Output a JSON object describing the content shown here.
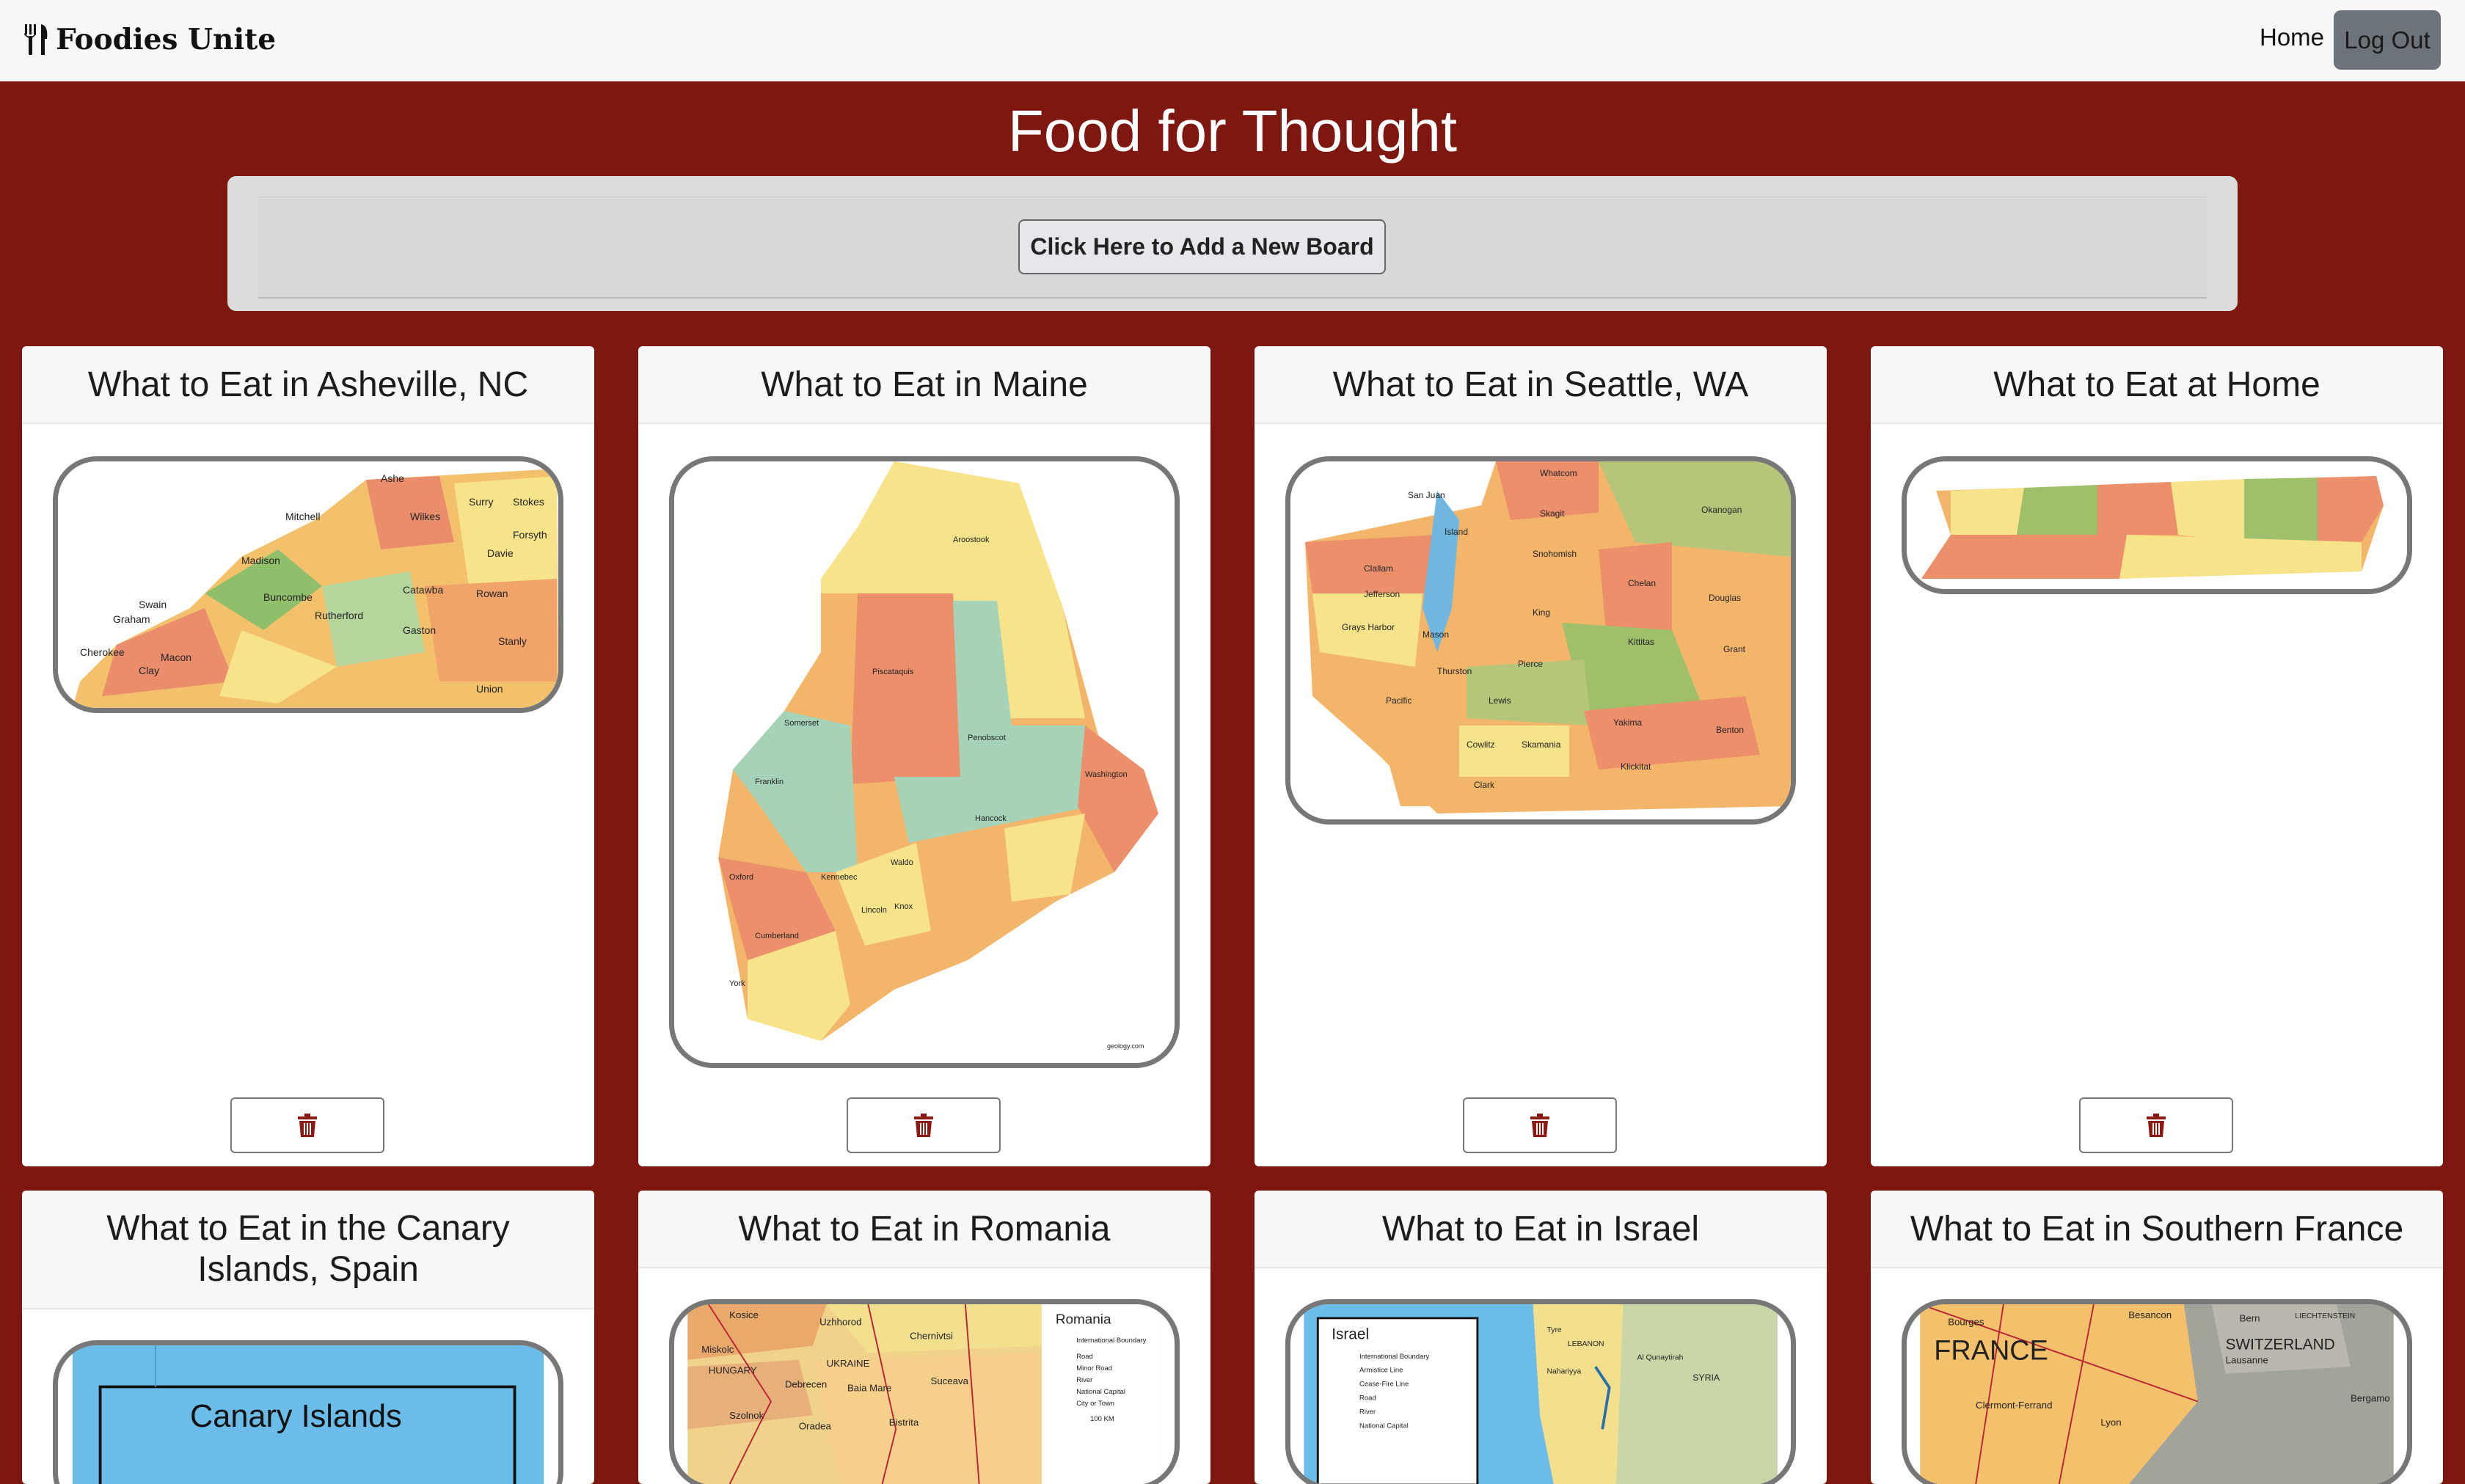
{
  "navbar": {
    "brand": "Foodies Unite",
    "brand_icon": "utensils-icon",
    "home_label": "Home",
    "logout_label": "Log Out"
  },
  "page": {
    "title": "Food for Thought",
    "add_board_label": "Click Here to Add a New Board"
  },
  "boards": [
    {
      "title": "What to Eat in Asheville, NC"
    },
    {
      "title": "What to Eat in Maine"
    },
    {
      "title": "What to Eat in Seattle, WA"
    },
    {
      "title": "What to Eat at Home"
    },
    {
      "title": "What to Eat in the Canary Islands, Spain"
    },
    {
      "title": "What to Eat in Romania"
    },
    {
      "title": "What to Eat in Israel"
    },
    {
      "title": "What to Eat in Southern France"
    }
  ],
  "map_labels": {
    "nc": [
      "Ashe",
      "Mitchell",
      "Wilkes",
      "Surry",
      "Stokes",
      "Forsyth",
      "Madison",
      "Buncombe",
      "Swain",
      "Graham",
      "Cherokee",
      "Macon",
      "Clay",
      "Catawba",
      "Rowan",
      "Gaston",
      "Union",
      "Stanly",
      "Rutherford",
      "Davie"
    ],
    "maine": [
      "Aroostook",
      "Piscataquis",
      "Somerset",
      "Penobscot",
      "Franklin",
      "Washington",
      "Hancock",
      "Oxford",
      "Kennebec",
      "Waldo",
      "Knox",
      "Lincoln",
      "Cumberland",
      "York",
      "geology.com"
    ],
    "wa": [
      "Whatcom",
      "San Juan",
      "Skagit",
      "Okanogan",
      "Island",
      "Snohomish",
      "Clallam",
      "Chelan",
      "Jefferson",
      "Douglas",
      "King",
      "Grays Harbor",
      "Mason",
      "Kittitas",
      "Grant",
      "Thurston",
      "Pierce",
      "Pacific",
      "Lewis",
      "Yakima",
      "Benton",
      "Cowlitz",
      "Skamania",
      "Klickitat",
      "Clark"
    ],
    "romania": [
      "Romania",
      "Kosice",
      "Uzhhorod",
      "Chernivtsi",
      "Miskolc",
      "HUNGARY",
      "UKRAINE",
      "Debrecen",
      "Baia Mare",
      "Suceava",
      "Szolnok",
      "Oradea",
      "Bistrita",
      "International Boundary",
      "Road",
      "Minor Road",
      "River",
      "National Capital",
      "City or Town",
      "100 KM"
    ],
    "israel": [
      "Israel",
      "International Boundary",
      "Armistice Line",
      "Cease-Fire Line",
      "Road",
      "River",
      "National Capital",
      "LEBANON",
      "Tyre",
      "SYRIA",
      "Al Qunaytirah",
      "Nahariyya"
    ],
    "france": [
      "FRANCE",
      "SWITZERLAND",
      "Bern",
      "Lausanne",
      "Besancon",
      "Bourges",
      "Clermont-Ferrand",
      "Lyon",
      "Bergamo",
      "LIECHTENSTEIN"
    ],
    "canary": [
      "Canary Islands"
    ]
  },
  "colors": {
    "page_bg": "#7f1711",
    "delete_icon": "#8b1a12"
  }
}
